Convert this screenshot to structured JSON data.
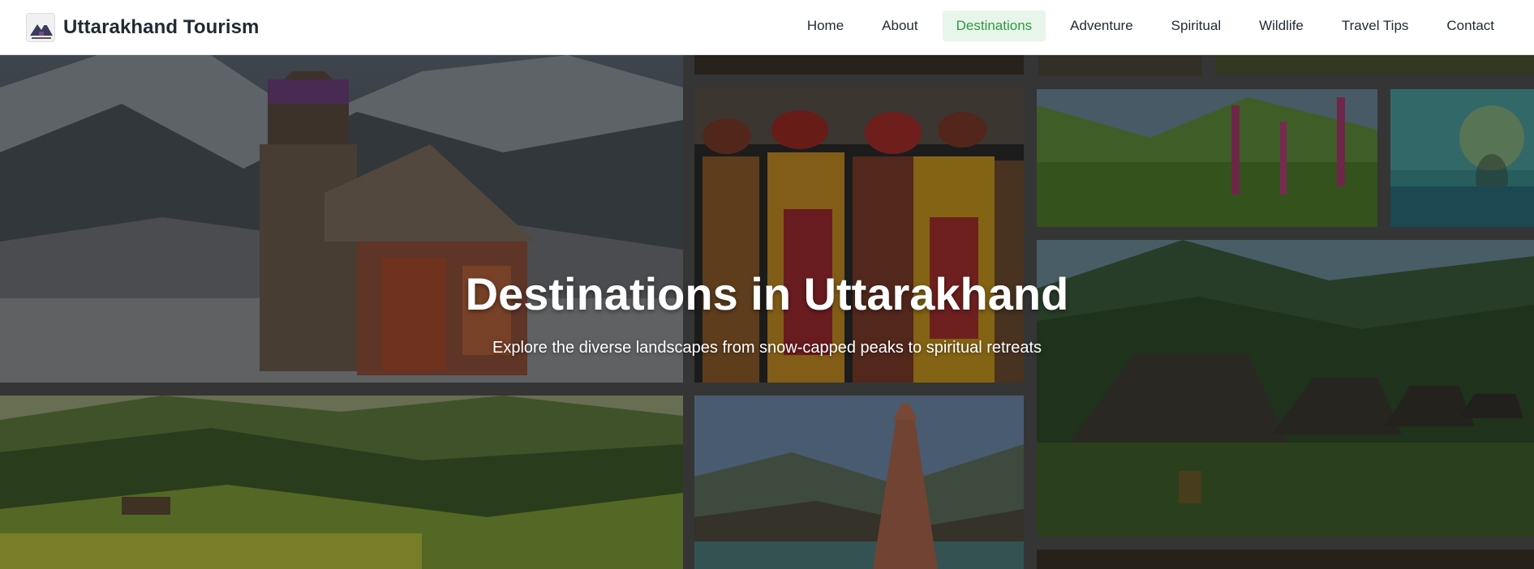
{
  "header": {
    "brand_title": "Uttarakhand Tourism",
    "logo_icon": "mountain-temple-logo-icon",
    "nav": [
      {
        "label": "Home",
        "active": false
      },
      {
        "label": "About",
        "active": false
      },
      {
        "label": "Destinations",
        "active": true
      },
      {
        "label": "Adventure",
        "active": false
      },
      {
        "label": "Spiritual",
        "active": false
      },
      {
        "label": "Wildlife",
        "active": false
      },
      {
        "label": "Travel Tips",
        "active": false
      },
      {
        "label": "Contact",
        "active": false
      }
    ]
  },
  "hero": {
    "title": "Destinations in Uttarakhand",
    "subtitle": "Explore the diverse landscapes from snow-capped peaks to spiritual retreats"
  },
  "colors": {
    "active_nav_bg": "#e7f5ea",
    "active_nav_text": "#2e9a3e",
    "text_dark": "#1f2a33"
  }
}
